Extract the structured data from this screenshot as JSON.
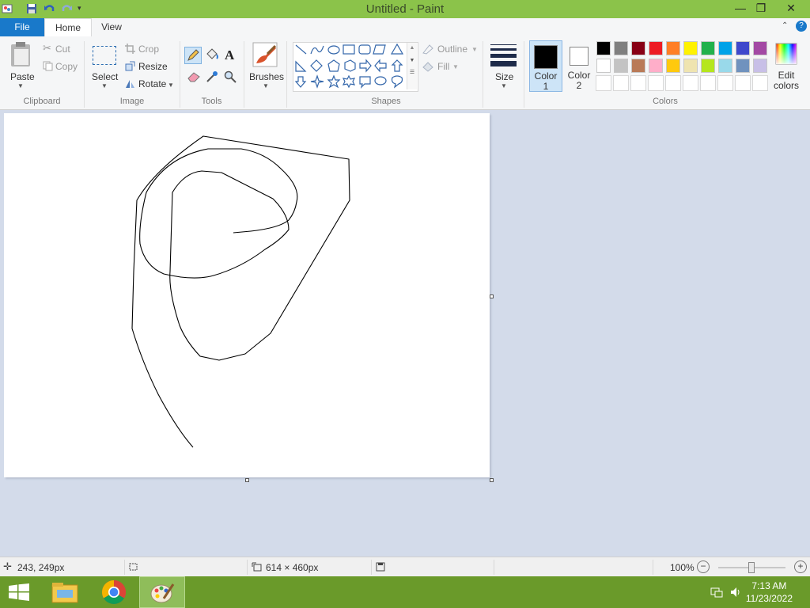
{
  "window": {
    "title": "Untitled - Paint"
  },
  "tabs": {
    "file": "File",
    "home": "Home",
    "view": "View"
  },
  "clipboard": {
    "group_label": "Clipboard",
    "paste": "Paste",
    "cut": "Cut",
    "copy": "Copy"
  },
  "image": {
    "group_label": "Image",
    "select": "Select",
    "crop": "Crop",
    "resize": "Resize",
    "rotate": "Rotate"
  },
  "tools": {
    "group_label": "Tools"
  },
  "brushes": {
    "label": "Brushes"
  },
  "shapes": {
    "group_label": "Shapes",
    "outline": "Outline",
    "fill": "Fill"
  },
  "size": {
    "label": "Size"
  },
  "colors": {
    "group_label": "Colors",
    "color1_l1": "Color",
    "color1_l2": "1",
    "color2_l1": "Color",
    "color2_l2": "2",
    "edit_l1": "Edit",
    "edit_l2": "colors",
    "color1_value": "#000000",
    "color2_value": "#ffffff",
    "row1": [
      "#000000",
      "#7f7f7f",
      "#880015",
      "#ed1c24",
      "#ff7f27",
      "#fff200",
      "#22b14c",
      "#00a2e8",
      "#3f48cc",
      "#a349a4"
    ],
    "row2": [
      "#ffffff",
      "#c3c3c3",
      "#b97a57",
      "#ffaec9",
      "#ffc90e",
      "#efe4b0",
      "#b5e61d",
      "#99d9ea",
      "#7092be",
      "#c8bfe7"
    ]
  },
  "status": {
    "cursor_pos": "243, 249px",
    "canvas_size": "614 × 460px",
    "zoom": "100%"
  },
  "taskbar": {
    "time": "7:13 AM",
    "date": "11/23/2022"
  },
  "theme": {
    "titlebar": "#8bc34a",
    "taskbar": "#6a9a2a",
    "accent": "#1979ca"
  }
}
